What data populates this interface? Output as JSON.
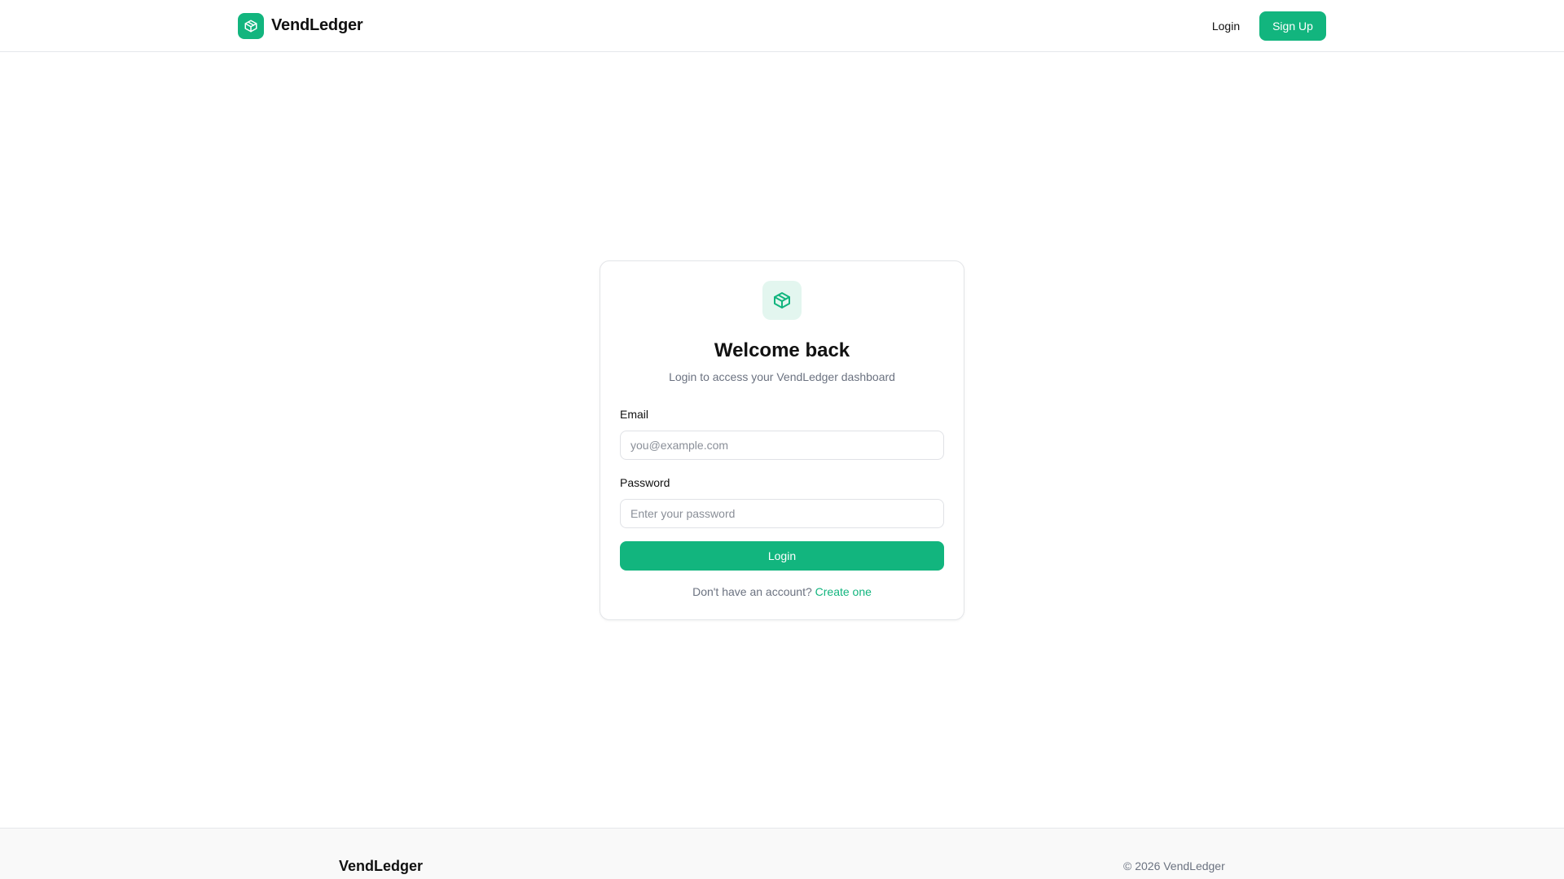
{
  "header": {
    "brand_name": "VendLedger",
    "brand_icon": "package-icon",
    "login_label": "Login",
    "signup_label": "Sign Up"
  },
  "login_card": {
    "icon": "package-icon",
    "title": "Welcome back",
    "subtitle": "Login to access your VendLedger dashboard",
    "email_label": "Email",
    "email_placeholder": "you@example.com",
    "email_value": "",
    "password_label": "Password",
    "password_placeholder": "Enter your password",
    "password_value": "",
    "submit_label": "Login",
    "no_account_text": "Don't have an account?",
    "create_link_label": "Create one"
  },
  "footer": {
    "brand_name": "VendLedger",
    "copyright": "© 2026 VendLedger"
  },
  "colors": {
    "accent": "#12b57e",
    "accent_soft": "#e3f6ef",
    "muted_text": "#6b7280",
    "border": "#e5e7eb"
  }
}
